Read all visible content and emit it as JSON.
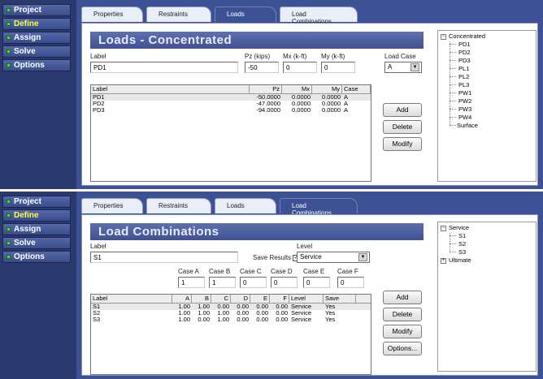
{
  "nav": [
    {
      "label": "Project",
      "active": false
    },
    {
      "label": "Define",
      "active": true
    },
    {
      "label": "Assign",
      "active": false
    },
    {
      "label": "Solve",
      "active": false
    },
    {
      "label": "Options",
      "active": false
    }
  ],
  "tabs": [
    "Properties",
    "Restraints",
    "Loads",
    "Load Combinations"
  ],
  "loads": {
    "title": "Loads - Concentrated",
    "label_caption": "Label",
    "label_value": "PD1",
    "pz_caption": "Pz (kips)",
    "pz_value": "-50",
    "mx_caption": "Mx (k-ft)",
    "mx_value": "0",
    "my_caption": "My (k-ft)",
    "my_value": "0",
    "case_caption": "Load Case",
    "case_value": "A",
    "columns": [
      "Label",
      "Pz",
      "Mx",
      "My",
      "Case"
    ],
    "rows": [
      [
        "PD1",
        "-50.0000",
        "0.0000",
        "0.0000",
        "A"
      ],
      [
        "PD2",
        "-47.0000",
        "0.0000",
        "0.0000",
        "A"
      ],
      [
        "PD3",
        "-94.0000",
        "0.0000",
        "0.0000",
        "A"
      ]
    ],
    "buttons": {
      "add": "Add",
      "delete": "Delete",
      "modify": "Modify"
    },
    "tree": {
      "root": "Concentrated",
      "children": [
        "PD1",
        "PD2",
        "PD3",
        "PL1",
        "PL2",
        "PL3",
        "PW1",
        "PW2",
        "PW3",
        "PW4"
      ],
      "other": "Surface"
    }
  },
  "combos": {
    "title": "Load Combinations",
    "label_caption": "Label",
    "label_value": "S1",
    "save_results": "Save Results",
    "level_caption": "Level",
    "level_value": "Service",
    "case_captions": [
      "Case A",
      "Case B",
      "Case C",
      "Case D",
      "Case E",
      "Case F"
    ],
    "case_values": [
      "1",
      "1",
      "0",
      "0",
      "0",
      "0"
    ],
    "columns": [
      "Label",
      "A",
      "B",
      "C",
      "D",
      "E",
      "F",
      "Level",
      "Save"
    ],
    "rows": [
      [
        "S1",
        "1.00",
        "1.00",
        "0.00",
        "0.00",
        "0.00",
        "0.00",
        "Service",
        "Yes"
      ],
      [
        "S2",
        "1.00",
        "1.00",
        "1.00",
        "0.00",
        "0.00",
        "0.00",
        "Service",
        "Yes"
      ],
      [
        "S3",
        "1.00",
        "0.00",
        "1.00",
        "0.00",
        "0.00",
        "0.00",
        "Service",
        "Yes"
      ]
    ],
    "buttons": {
      "add": "Add",
      "delete": "Delete",
      "modify": "Modify",
      "options": "Options..."
    },
    "tree": {
      "root": "Service",
      "children": [
        "S1",
        "S2",
        "S3"
      ],
      "other": "Ultimate"
    }
  }
}
